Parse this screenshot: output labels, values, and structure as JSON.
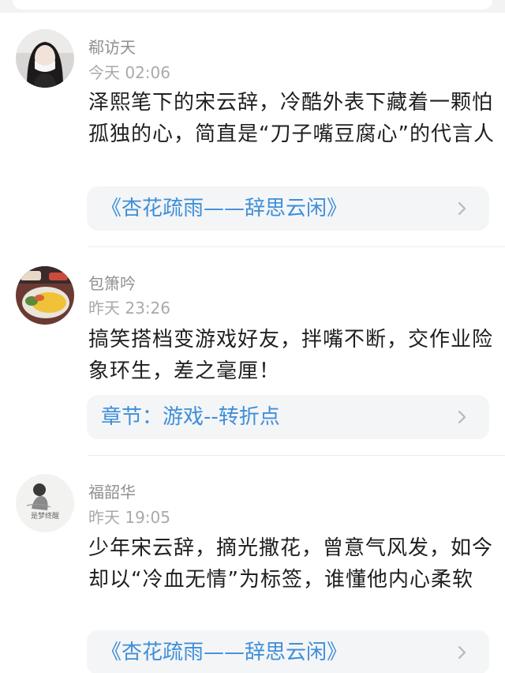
{
  "comments": [
    {
      "username": "郗访天",
      "time": "今天 02:06",
      "content": "泽熙笔下的宋云辞，冷酷外表下藏着一颗怕孤独的心，简直是“刀子嘴豆腐心”的代言人",
      "link": "《杏花疏雨——辞思云闲》"
    },
    {
      "username": "包箫吟",
      "time": "昨天 23:26",
      "content": "搞笑搭档变游戏好友，拌嘴不断，交作业险象环生，差之毫厘！",
      "link": "章节：游戏--转折点"
    },
    {
      "username": "福韶华",
      "time": "昨天 19:05",
      "content": "少年宋云辞，摘光撒花，曾意气风发，如今却以“冷血无情”为标签，谁懂他内心柔软",
      "link": "《杏花疏雨——辞思云闲》",
      "avatar_caption": "是梦终醒"
    }
  ],
  "icons": {
    "chevron": "chevron-right-icon"
  },
  "colors": {
    "link": "#3e8fd8",
    "card_bg": "#f4f5f7",
    "meta": "#a9a9ae"
  }
}
